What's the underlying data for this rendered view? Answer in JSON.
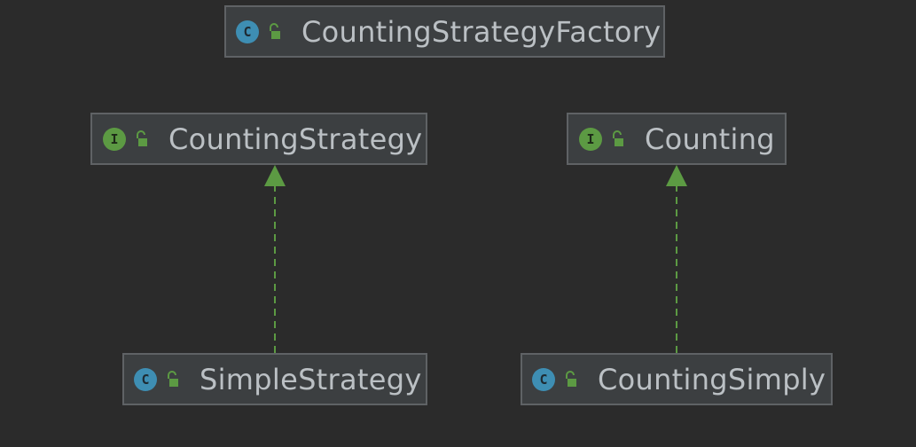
{
  "diagram": {
    "nodes": {
      "factory": {
        "name": "CountingStrategyFactory",
        "kind": "class",
        "kind_letter": "C"
      },
      "counting_strategy": {
        "name": "CountingStrategy",
        "kind": "interface",
        "kind_letter": "I"
      },
      "counting": {
        "name": "Counting",
        "kind": "interface",
        "kind_letter": "I"
      },
      "simple_strategy": {
        "name": "SimpleStrategy",
        "kind": "class",
        "kind_letter": "C"
      },
      "counting_simply": {
        "name": "CountingSimply",
        "kind": "class",
        "kind_letter": "C"
      }
    },
    "edges": [
      {
        "from": "SimpleStrategy",
        "to": "CountingStrategy",
        "type": "implements"
      },
      {
        "from": "CountingSimply",
        "to": "Counting",
        "type": "implements"
      }
    ],
    "colors": {
      "background": "#2b2b2b",
      "node_fill": "#3c3f41",
      "node_border": "#5f6265",
      "text": "#bbc0c4",
      "class_badge": "#3e8eb3",
      "interface_badge": "#5c9a43",
      "lock_icon": "#5c9a43",
      "implements_edge": "#5c9a43"
    },
    "icons": {
      "class_badge": "class-icon",
      "interface_badge": "interface-icon",
      "visibility": "unlocked-padlock-icon"
    }
  }
}
